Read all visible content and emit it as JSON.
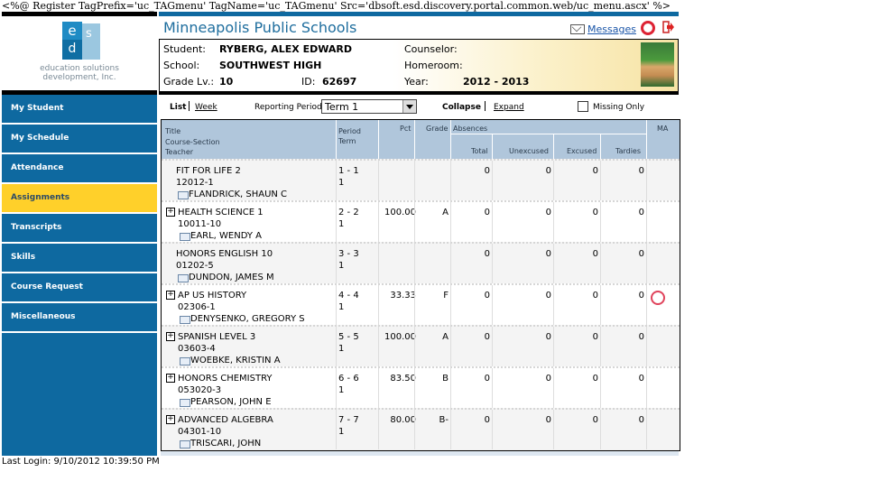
{
  "top_code": "<%@ Register TagPrefix='uc_TAGmenu' TagName='uc_TAGmenu' Src='dbsoft.esd.discovery.portal.common.web/uc_menu.ascx' %>",
  "logo": {
    "letters": [
      "e",
      "s",
      "d"
    ],
    "line1": "education solutions",
    "line2": "development, Inc."
  },
  "menu": [
    {
      "label": "My Student",
      "active": false
    },
    {
      "label": "My Schedule",
      "active": false
    },
    {
      "label": "Attendance",
      "active": false
    },
    {
      "label": "Assignments",
      "active": true
    },
    {
      "label": "Transcripts",
      "active": false
    },
    {
      "label": "Skills",
      "active": false
    },
    {
      "label": "Course Request",
      "active": false
    },
    {
      "label": "Miscellaneous",
      "active": false
    }
  ],
  "last_login": "Last Login: 9/10/2012 10:39:50 PM",
  "header": {
    "title": "Minneapolis Public Schools",
    "messages": "Messages"
  },
  "student": {
    "student_label": "Student:",
    "student_name": "RYBERG, ALEX EDWARD",
    "school_label": "School:",
    "school_name": "SOUTHWEST HIGH",
    "grade_label": "Grade Lv.:",
    "grade_value": "10",
    "id_label": "ID:",
    "id_value": "62697",
    "counselor_label": "Counselor:",
    "homeroom_label": "Homeroom:",
    "year_label": "Year:",
    "year_value": "2012 - 2013"
  },
  "controls": {
    "list": "List",
    "week": "Week",
    "reporting_period_label": "Reporting Period:",
    "reporting_period_value": "Term 1",
    "collapse": "Collapse",
    "expand": "Expand",
    "missing_only": "Missing Only"
  },
  "table_headers": {
    "title": "Title",
    "course_section": "Course-Section",
    "teacher": "Teacher",
    "period": "Period",
    "term": "Term",
    "pct": "Pct",
    "grade": "Grade",
    "absences": "Absences",
    "total": "Total",
    "unexcused": "Unexcused",
    "excused": "Excused",
    "tardies": "Tardies",
    "ma": "MA"
  },
  "rows": [
    {
      "title": "FIT FOR LIFE 2",
      "section": "12012-1",
      "teacher": "FLANDRICK, SHAUN C",
      "period": "1 - 1",
      "term": "1",
      "pct": "",
      "grade": "",
      "total": "0",
      "unexcused": "0",
      "excused": "0",
      "tardies": "0",
      "expandable": false,
      "alert": false
    },
    {
      "title": "HEALTH SCIENCE 1",
      "section": "10011-10",
      "teacher": "EARL, WENDY A",
      "period": "2 - 2",
      "term": "1",
      "pct": "100.00",
      "grade": "A",
      "total": "0",
      "unexcused": "0",
      "excused": "0",
      "tardies": "0",
      "expandable": true,
      "alert": false
    },
    {
      "title": "HONORS ENGLISH 10",
      "section": "01202-5",
      "teacher": "DUNDON, JAMES M",
      "period": "3 - 3",
      "term": "1",
      "pct": "",
      "grade": "",
      "total": "0",
      "unexcused": "0",
      "excused": "0",
      "tardies": "0",
      "expandable": false,
      "alert": false
    },
    {
      "title": "AP US HISTORY",
      "section": "02306-1",
      "teacher": "DENYSENKO, GREGORY S",
      "period": "4 - 4",
      "term": "1",
      "pct": "33.33",
      "grade": "F",
      "total": "0",
      "unexcused": "0",
      "excused": "0",
      "tardies": "0",
      "expandable": true,
      "alert": true
    },
    {
      "title": "SPANISH LEVEL 3",
      "section": "03603-4",
      "teacher": "WOEBKE, KRISTIN A",
      "period": "5 - 5",
      "term": "1",
      "pct": "100.00",
      "grade": "A",
      "total": "0",
      "unexcused": "0",
      "excused": "0",
      "tardies": "0",
      "expandable": true,
      "alert": false
    },
    {
      "title": "HONORS CHEMISTRY",
      "section": "053020-3",
      "teacher": "PEARSON, JOHN E",
      "period": "6 - 6",
      "term": "1",
      "pct": "83.50",
      "grade": "B",
      "total": "0",
      "unexcused": "0",
      "excused": "0",
      "tardies": "0",
      "expandable": true,
      "alert": false
    },
    {
      "title": "ADVANCED ALGEBRA",
      "section": "04301-10",
      "teacher": "TRISCARI, JOHN",
      "period": "7 - 7",
      "term": "1",
      "pct": "80.00",
      "grade": "B-",
      "total": "0",
      "unexcused": "0",
      "excused": "0",
      "tardies": "0",
      "expandable": true,
      "alert": false
    }
  ]
}
